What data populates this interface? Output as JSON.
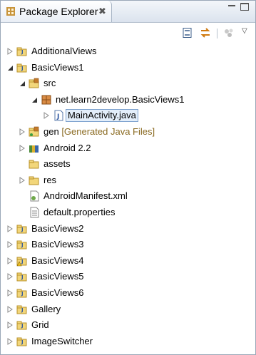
{
  "view": {
    "title": "Package Explorer",
    "close_glyph": "✖"
  },
  "toolbar": {
    "buttons": [
      "collapse-all-icon",
      "link-with-editor-icon",
      "focus-on-active-task-icon",
      "view-menu-icon"
    ]
  },
  "tree": [
    {
      "label": "AdditionalViews",
      "icon": "java-project-icon",
      "expanded": false,
      "depth": 0
    },
    {
      "label": "BasicViews1",
      "icon": "java-project-icon",
      "expanded": true,
      "depth": 0
    },
    {
      "label": "src",
      "icon": "source-folder-icon",
      "expanded": true,
      "depth": 1
    },
    {
      "label": "net.learn2develop.BasicViews1",
      "icon": "package-icon",
      "expanded": true,
      "depth": 2
    },
    {
      "label": "MainActivity.java",
      "icon": "java-file-icon",
      "expanded": false,
      "depth": 3,
      "selected": true
    },
    {
      "label": "gen",
      "decoration": "[Generated Java Files]",
      "icon": "generated-folder-icon",
      "expanded": false,
      "depth": 1
    },
    {
      "label": "Android 2.2",
      "icon": "android-library-icon",
      "expanded": false,
      "depth": 1
    },
    {
      "label": "assets",
      "icon": "folder-icon",
      "depth": 1
    },
    {
      "label": "res",
      "icon": "folder-icon",
      "expanded": false,
      "depth": 1
    },
    {
      "label": "AndroidManifest.xml",
      "icon": "xml-file-icon",
      "depth": 1
    },
    {
      "label": "default.properties",
      "icon": "text-file-icon",
      "depth": 1
    },
    {
      "label": "BasicViews2",
      "icon": "java-project-icon",
      "expanded": false,
      "depth": 0
    },
    {
      "label": "BasicViews3",
      "icon": "java-project-icon",
      "expanded": false,
      "depth": 0
    },
    {
      "label": "BasicViews4",
      "icon": "java-project-warning-icon",
      "expanded": false,
      "depth": 0
    },
    {
      "label": "BasicViews5",
      "icon": "java-project-icon",
      "expanded": false,
      "depth": 0
    },
    {
      "label": "BasicViews6",
      "icon": "java-project-icon",
      "expanded": false,
      "depth": 0
    },
    {
      "label": "Gallery",
      "icon": "java-project-icon",
      "expanded": false,
      "depth": 0
    },
    {
      "label": "Grid",
      "icon": "java-project-icon",
      "expanded": false,
      "depth": 0
    },
    {
      "label": "ImageSwitcher",
      "icon": "java-project-icon",
      "expanded": false,
      "depth": 0
    }
  ]
}
